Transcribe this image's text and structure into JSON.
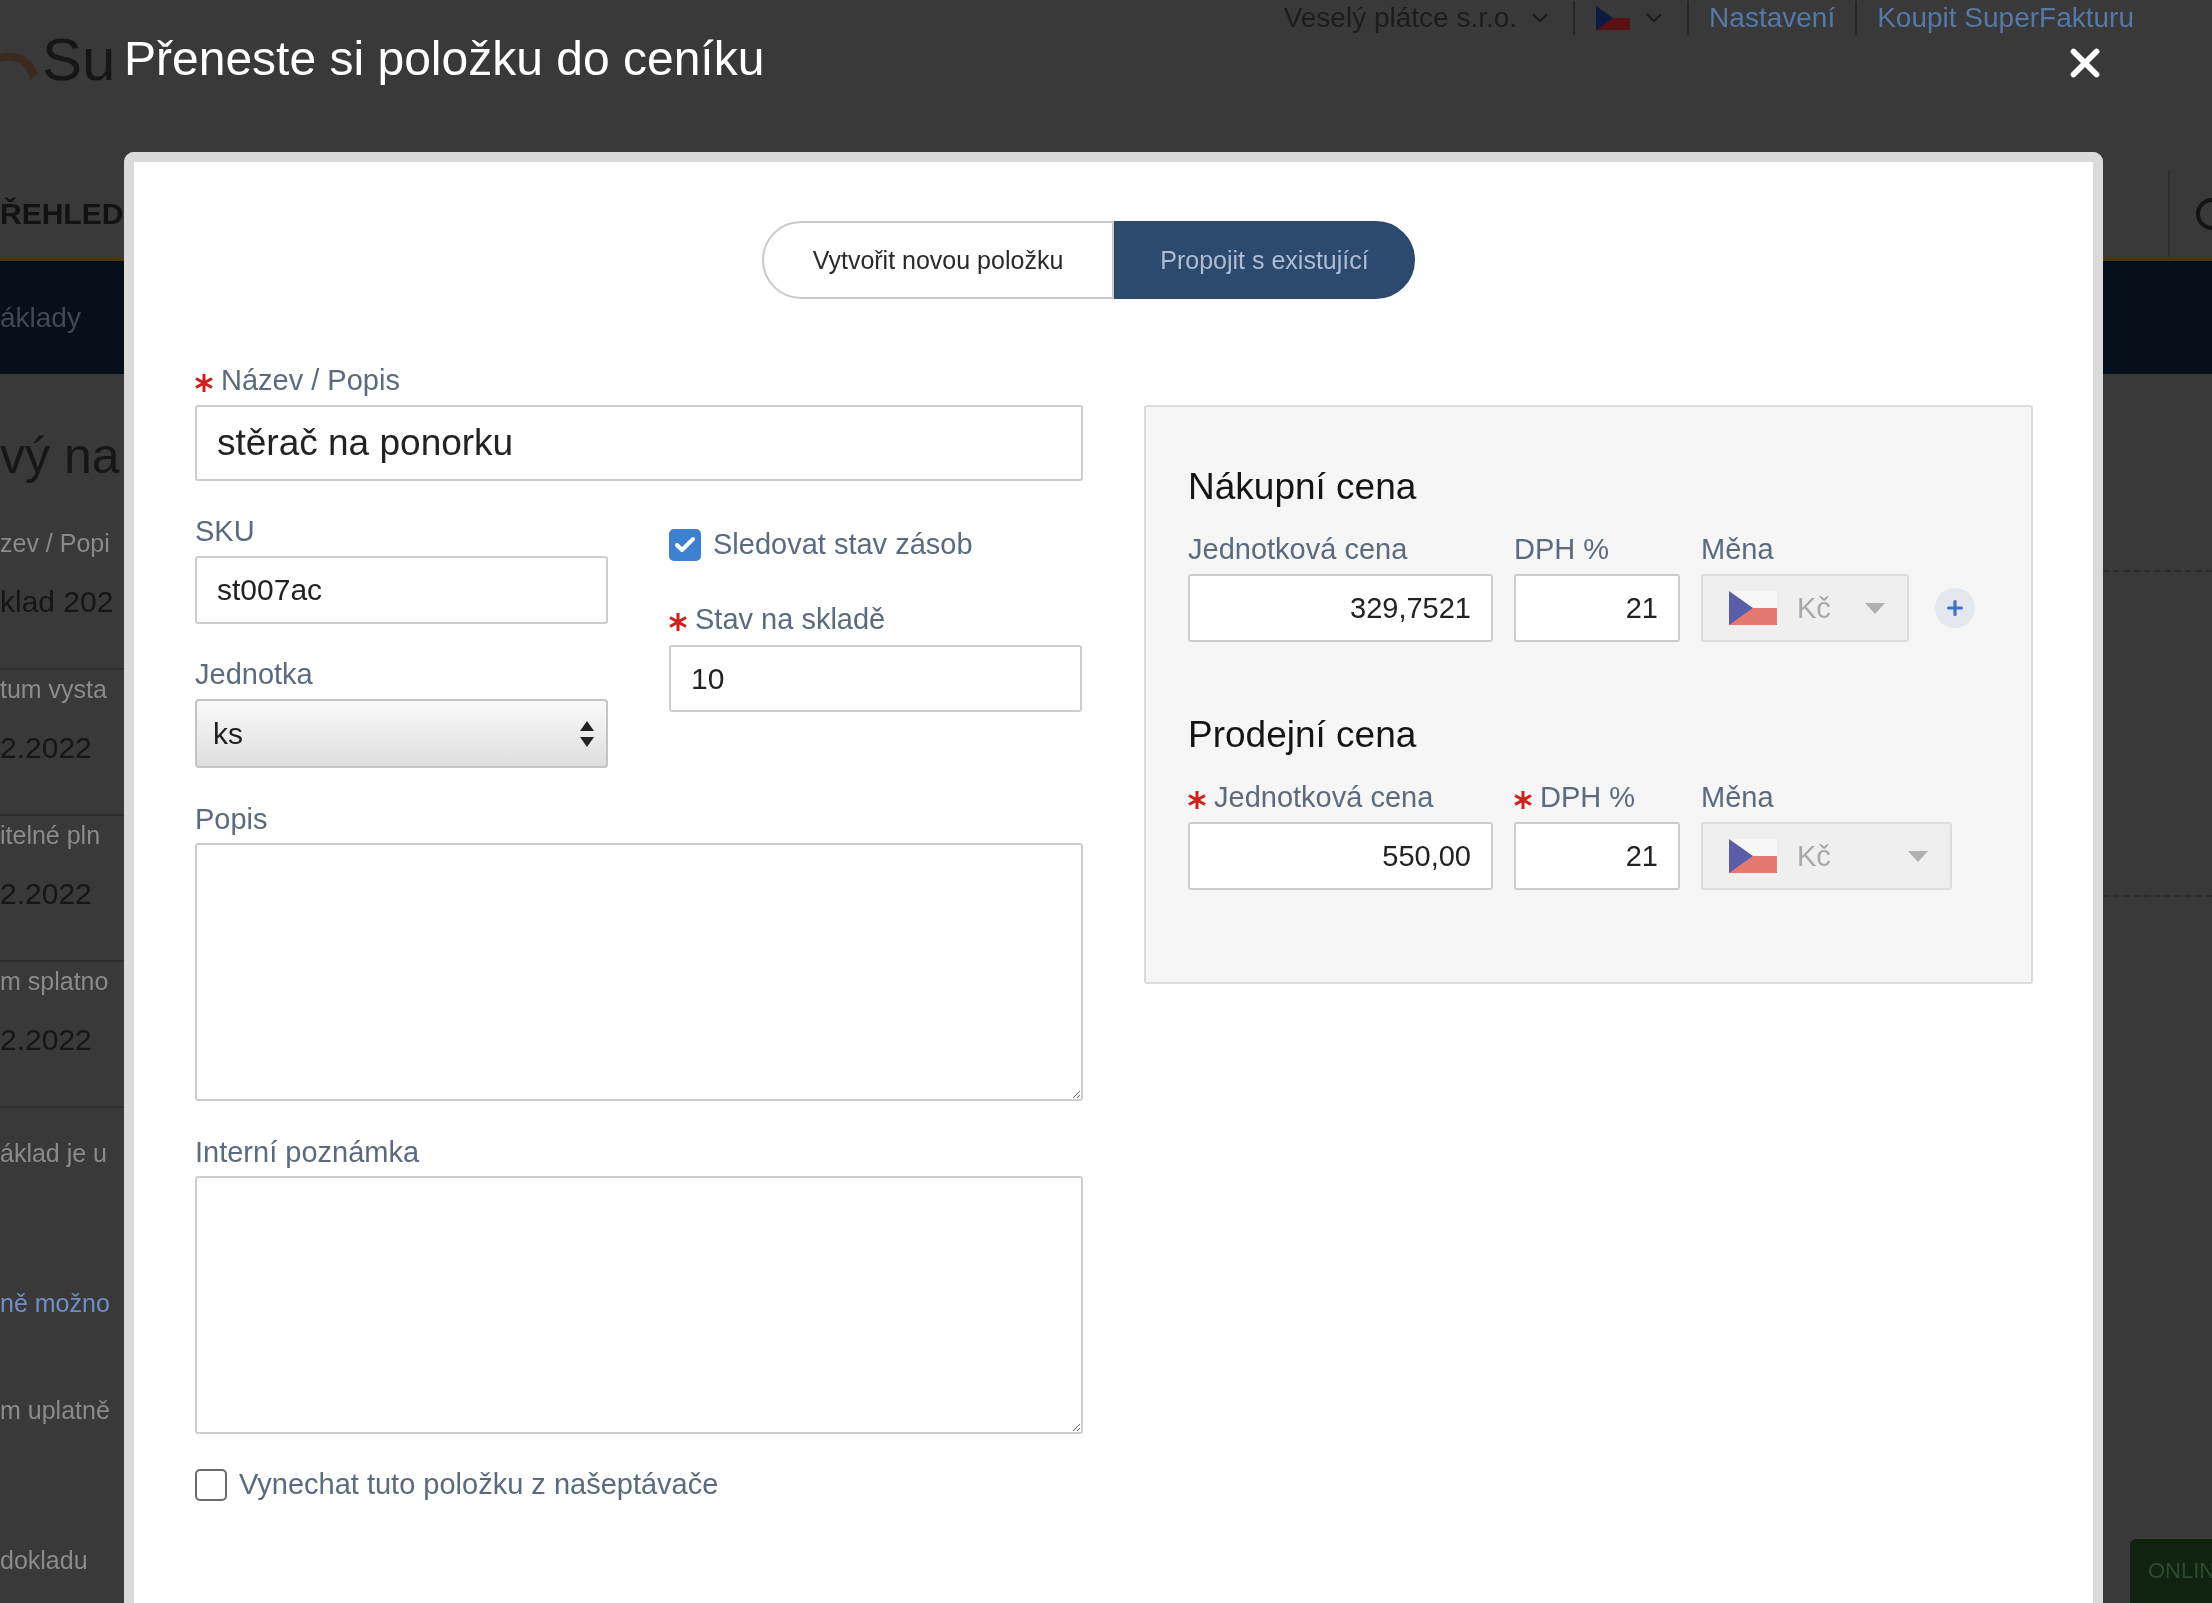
{
  "background_page": {
    "logo": {
      "text": "Su"
    },
    "nav": {
      "company": "Veselý plátce s.r.o.",
      "links": [
        "Nastavení",
        "Koupit SuperFakturu"
      ]
    },
    "section_tab": "ŘEHLED",
    "menu_item": "áklady",
    "left_column": [
      {
        "kind": "heading",
        "text": "vý na"
      },
      {
        "kind": "label",
        "text": "zev / Popi"
      },
      {
        "kind": "value",
        "text": "klad 202"
      },
      {
        "kind": "label",
        "text": "tum vysta"
      },
      {
        "kind": "value",
        "text": "2.2022"
      },
      {
        "kind": "label",
        "text": "itelné pln"
      },
      {
        "kind": "value",
        "text": "2.2022"
      },
      {
        "kind": "label",
        "text": "m splatno"
      },
      {
        "kind": "value",
        "text": "2.2022"
      },
      {
        "kind": "note",
        "text": "áklad je u"
      },
      {
        "kind": "link",
        "text": "ně možno"
      },
      {
        "kind": "note",
        "text": "m uplatně"
      },
      {
        "kind": "note",
        "text": "dokladu"
      }
    ],
    "online_button": "ONLIN"
  },
  "modal": {
    "title": "Přeneste si položku do ceníku",
    "tabs": [
      {
        "label": "Vytvořit novou položku",
        "selected": false
      },
      {
        "label": "Propojit s existující",
        "selected": true
      }
    ],
    "name": {
      "label": "Název / Popis",
      "required": true,
      "value": "stěrač na ponorku"
    },
    "sku": {
      "label": "SKU",
      "required": false,
      "value": "st007ac"
    },
    "track_stock": {
      "label": "Sledovat stav zásob",
      "checked": true
    },
    "unit": {
      "label": "Jednotka",
      "required": false,
      "value": "ks"
    },
    "stock": {
      "label": "Stav na skladě",
      "required": true,
      "value": "10"
    },
    "description": {
      "label": "Popis",
      "required": false
    },
    "internal_note": {
      "label": "Interní poznámka",
      "required": false
    },
    "exclude": {
      "label": "Vynechat tuto položku z našeptávače",
      "checked": false
    },
    "price_sections": [
      {
        "title": "Nákupní cena",
        "add_button": true,
        "fields": [
          {
            "kind": "number",
            "label": "Jednotková cena",
            "required": false,
            "value": "329,7521"
          },
          {
            "kind": "number",
            "label": "DPH %",
            "required": false,
            "value": "21"
          },
          {
            "kind": "currency",
            "label": "Měna",
            "required": false,
            "value": "Kč"
          }
        ]
      },
      {
        "title": "Prodejní cena",
        "add_button": false,
        "fields": [
          {
            "kind": "number",
            "label": "Jednotková cena",
            "required": true,
            "value": "550,00"
          },
          {
            "kind": "number",
            "label": "DPH %",
            "required": true,
            "value": "21"
          },
          {
            "kind": "currency",
            "label": "Měna",
            "required": false,
            "value": "Kč"
          }
        ]
      }
    ]
  }
}
